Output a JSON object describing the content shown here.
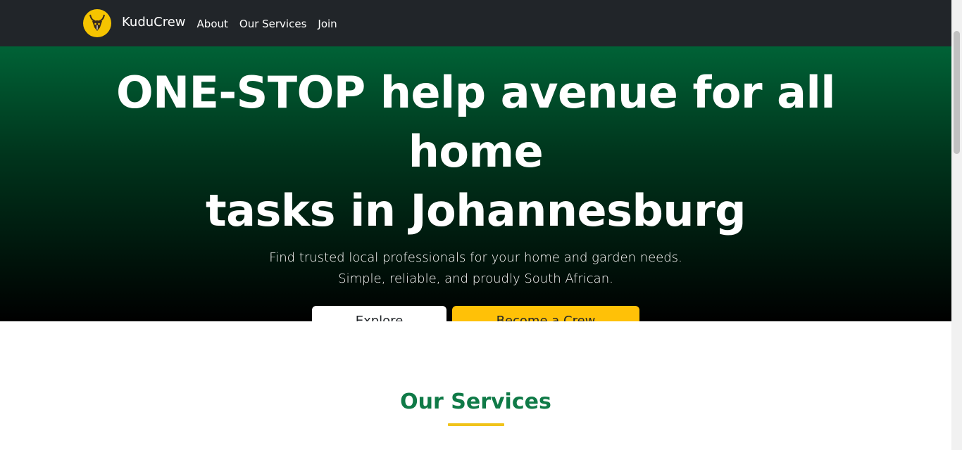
{
  "navbar": {
    "brand": "KuduCrew",
    "logo_icon": "kudu-antelope-icon",
    "links": [
      {
        "label": "About"
      },
      {
        "label": "Our Services"
      },
      {
        "label": "Join"
      }
    ]
  },
  "hero": {
    "title_line1": "ONE-STOP help avenue for all home",
    "title_line2": "tasks in Johannesburg",
    "subtitle": "Find trusted local professionals for your home and garden needs. Simple, reliable, and proudly South African.",
    "primary_button": "Explore Services",
    "secondary_button": "Become a Crew Member"
  },
  "services": {
    "title": "Our Services"
  },
  "colors": {
    "nav_bg": "#212529",
    "hero_top": "#006236",
    "hero_bottom": "#000000",
    "accent_yellow": "#ffc107",
    "green_heading": "#0f7a47"
  }
}
